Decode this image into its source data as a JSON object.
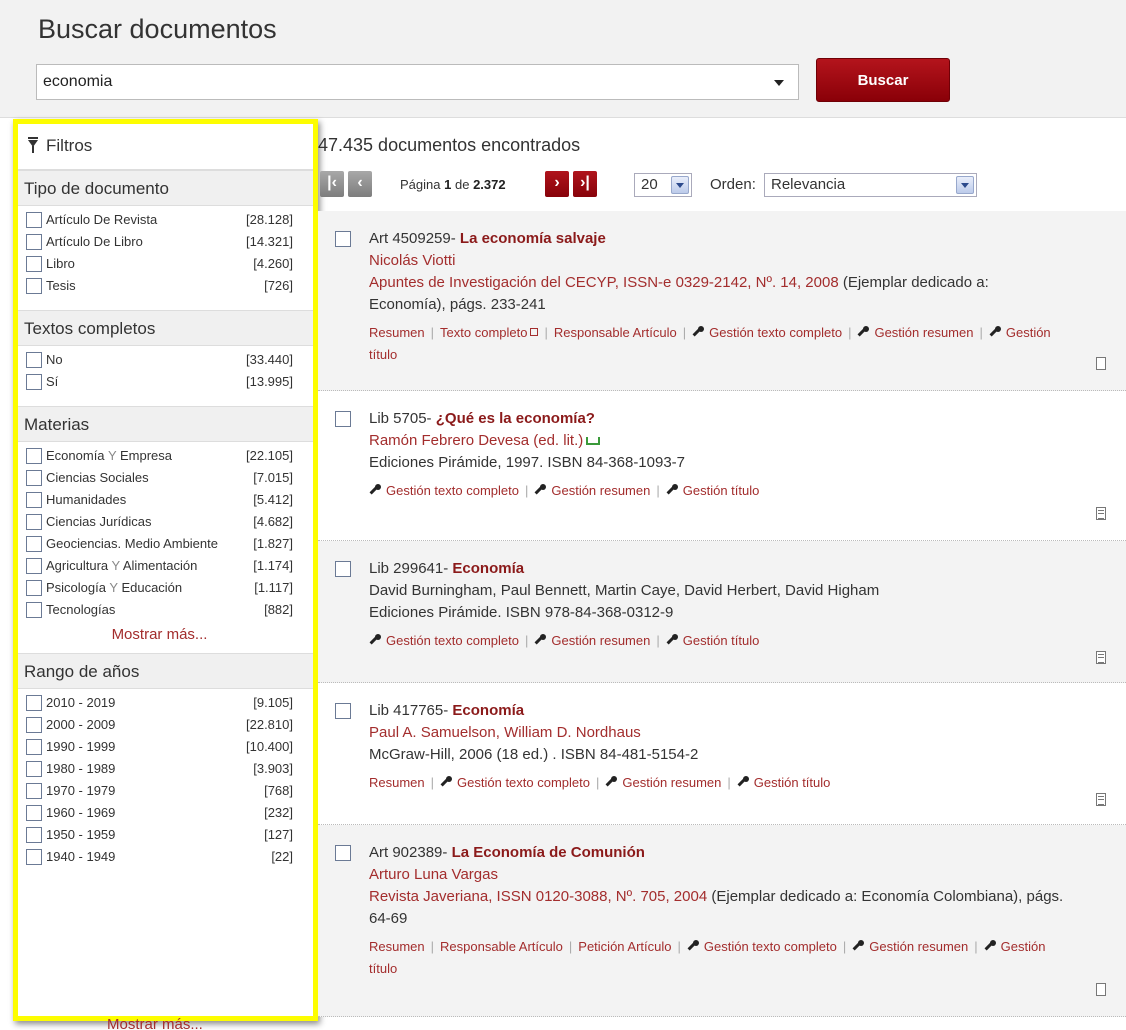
{
  "header": {
    "title": "Buscar documentos",
    "search_value": "economia",
    "search_button": "Buscar"
  },
  "sidebar": {
    "filters_label": "Filtros",
    "groups": [
      {
        "title": "Tipo de documento",
        "items": [
          {
            "label": "Artículo De Revista",
            "count": "[28.128]"
          },
          {
            "label": "Artículo De Libro",
            "count": "[14.321]"
          },
          {
            "label": "Libro",
            "count": "[4.260]"
          },
          {
            "label": "Tesis",
            "count": "[726]"
          }
        ]
      },
      {
        "title": "Textos completos",
        "items": [
          {
            "label": "No",
            "count": "[33.440]"
          },
          {
            "label": "Sí",
            "count": "[13.995]"
          }
        ]
      },
      {
        "title": "Materias",
        "items": [
          {
            "label_a": "Economía",
            "label_y": "Y",
            "label_b": "Empresa",
            "count": "[22.105]"
          },
          {
            "label": "Ciencias Sociales",
            "count": "[7.015]"
          },
          {
            "label": "Humanidades",
            "count": "[5.412]"
          },
          {
            "label": "Ciencias Jurídicas",
            "count": "[4.682]"
          },
          {
            "label": "Geociencias. Medio Ambiente",
            "count": "[1.827]"
          },
          {
            "label_a": "Agricultura",
            "label_y": "Y",
            "label_b": "Alimentación",
            "count": "[1.174]"
          },
          {
            "label_a": "Psicología",
            "label_y": "Y",
            "label_b": "Educación",
            "count": "[1.117]"
          },
          {
            "label": "Tecnologías",
            "count": "[882]"
          }
        ],
        "more": "Mostrar más..."
      },
      {
        "title": "Rango de años",
        "items": [
          {
            "label": "2010 - 2019",
            "count": "[9.105]"
          },
          {
            "label": "2000 - 2009",
            "count": "[22.810]"
          },
          {
            "label": "1990 - 1999",
            "count": "[10.400]"
          },
          {
            "label": "1980 - 1989",
            "count": "[3.903]"
          },
          {
            "label": "1970 - 1979",
            "count": "[768]"
          },
          {
            "label": "1960 - 1969",
            "count": "[232]"
          },
          {
            "label": "1950 - 1959",
            "count": "[127]"
          },
          {
            "label": "1940 - 1949",
            "count": "[22]"
          }
        ],
        "more": "Mostrar más..."
      }
    ]
  },
  "results": {
    "count_text": "47.435 documentos encontrados",
    "pager": {
      "page_prefix": "Página",
      "page_current": "1",
      "page_of": "de",
      "page_total": "2.372",
      "per_page": "20",
      "order_label": "Orden:",
      "order_value": "Relevancia"
    },
    "items": [
      {
        "ref": "Art 4509259-",
        "title": "La economía salvaje",
        "author": "Nicolás Viotti",
        "source_link": "Apuntes de Investigación del CECYP, ISSN-e 0329-2142, Nº. 14, 2008",
        "source_rest": " (Ejemplar dedicado a: Economía), págs. 233-241",
        "act_resumen": "Resumen",
        "act_texto": "Texto completo",
        "act_responsable": "Responsable Artículo",
        "act_gtc": "Gestión texto completo",
        "act_gr": "Gestión resumen",
        "act_gt": "Gestión título"
      },
      {
        "ref": "Lib 5705-",
        "title": "¿Qué es la economía?",
        "author": "Ramón Febrero Devesa (ed. lit.)",
        "source": "Ediciones Pirámide, 1997. ISBN 84-368-1093-7",
        "act_gtc": "Gestión texto completo",
        "act_gr": "Gestión resumen",
        "act_gt": "Gestión título"
      },
      {
        "ref": "Lib 299641-",
        "title": "Economía",
        "author": "David Burningham, Paul Bennett, Martin Caye, David Herbert, David Higham",
        "source": "Ediciones Pirámide. ISBN 978-84-368-0312-9",
        "act_gtc": "Gestión texto completo",
        "act_gr": "Gestión resumen",
        "act_gt": "Gestión título"
      },
      {
        "ref": "Lib 417765-",
        "title": "Economía",
        "author": "Paul A. Samuelson, William D. Nordhaus",
        "source": "McGraw-Hill, 2006 (18 ed.) . ISBN 84-481-5154-2",
        "act_resumen": "Resumen",
        "act_gtc": "Gestión texto completo",
        "act_gr": "Gestión resumen",
        "act_gt": "Gestión título"
      },
      {
        "ref": "Art 902389-",
        "title": "La Economía de Comunión",
        "author": "Arturo Luna Vargas",
        "source_link": "Revista Javeriana, ISSN 0120-3088, Nº. 705, 2004",
        "source_rest": " (Ejemplar dedicado a: Economía Colombiana), págs. 64-69",
        "act_resumen": "Resumen",
        "act_responsable": "Responsable Artículo",
        "act_peticion": "Petición Artículo",
        "act_gtc": "Gestión texto completo",
        "act_gr": "Gestión resumen",
        "act_gt": "Gestión título"
      }
    ]
  },
  "colors": {
    "accent_red": "#8b1a1a",
    "link_red": "#a32d2d",
    "highlight_yellow": "#fdfd00"
  }
}
